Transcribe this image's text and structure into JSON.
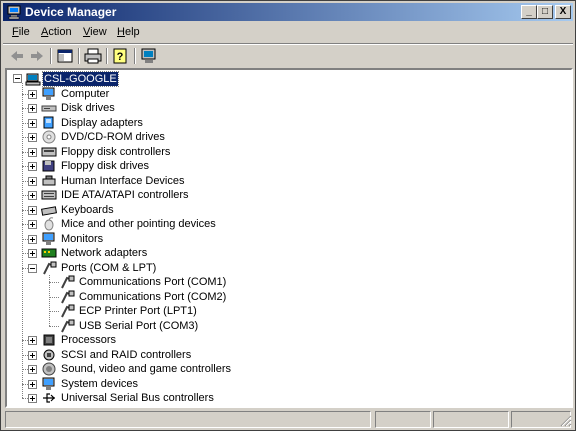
{
  "window": {
    "title": "Device Manager"
  },
  "title_buttons": [
    "_",
    "□",
    "X"
  ],
  "menu": [
    {
      "mnemonic": "F",
      "rest": "ile"
    },
    {
      "mnemonic": "A",
      "rest": "ction"
    },
    {
      "mnemonic": "V",
      "rest": "iew"
    },
    {
      "mnemonic": "H",
      "rest": "elp"
    }
  ],
  "toolbar": [
    "back-arrow-icon",
    "forward-arrow-icon",
    "show-hide-console-tree-icon",
    "print-icon",
    "properties-help-icon",
    "monitor-scan-icon"
  ],
  "tree": {
    "root": "CSL-GOOGLE",
    "categories": [
      {
        "label": "Computer",
        "icon": "computer-icon"
      },
      {
        "label": "Disk drives",
        "icon": "disk-drive-icon"
      },
      {
        "label": "Display adapters",
        "icon": "display-adapter-icon"
      },
      {
        "label": "DVD/CD-ROM drives",
        "icon": "cdrom-icon"
      },
      {
        "label": "Floppy disk controllers",
        "icon": "floppy-controller-icon"
      },
      {
        "label": "Floppy disk drives",
        "icon": "floppy-drive-icon"
      },
      {
        "label": "Human Interface Devices",
        "icon": "hid-icon"
      },
      {
        "label": "IDE ATA/ATAPI controllers",
        "icon": "ide-controller-icon"
      },
      {
        "label": "Keyboards",
        "icon": "keyboard-icon"
      },
      {
        "label": "Mice and other pointing devices",
        "icon": "mouse-icon"
      },
      {
        "label": "Monitors",
        "icon": "monitor-icon"
      },
      {
        "label": "Network adapters",
        "icon": "network-adapter-icon"
      },
      {
        "label": "Ports (COM & LPT)",
        "icon": "port-icon",
        "expanded": true,
        "children": [
          "Communications Port (COM1)",
          "Communications Port (COM2)",
          "ECP Printer Port (LPT1)",
          "USB Serial Port (COM3)"
        ]
      },
      {
        "label": "Processors",
        "icon": "processor-icon"
      },
      {
        "label": "SCSI and RAID controllers",
        "icon": "scsi-icon"
      },
      {
        "label": "Sound, video and game controllers",
        "icon": "sound-icon"
      },
      {
        "label": "System devices",
        "icon": "system-device-icon"
      },
      {
        "label": "Universal Serial Bus controllers",
        "icon": "usb-icon"
      }
    ]
  },
  "colors": {
    "title_start": "#0a246a",
    "title_end": "#a6caf0",
    "selection": "#0a246a",
    "face": "#d4d0c8"
  }
}
